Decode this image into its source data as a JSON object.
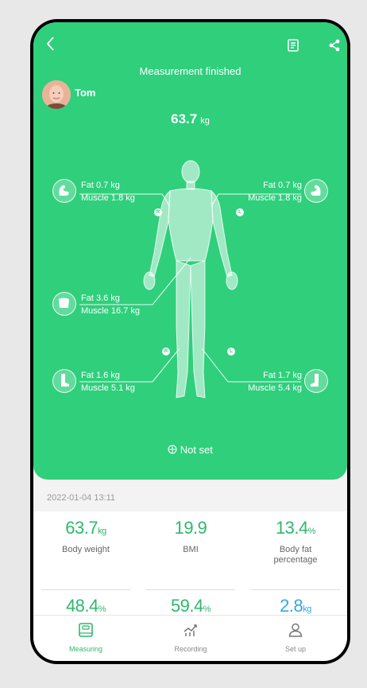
{
  "header": {
    "title": "Measurement finished"
  },
  "user": {
    "name": "Tom"
  },
  "weight": {
    "value": "63.7",
    "unit": "kg"
  },
  "segments": {
    "left_arm": {
      "fat": "Fat 0.7 kg",
      "muscle": "Muscle 1.8 kg"
    },
    "right_arm": {
      "fat": "Fat 0.7 kg",
      "muscle": "Muscle 1.8 kg"
    },
    "trunk": {
      "fat": "Fat 3.6 kg",
      "muscle": "Muscle 16.7 kg"
    },
    "left_leg": {
      "fat": "Fat 1.6 kg",
      "muscle": "Muscle 5.1 kg"
    },
    "right_leg": {
      "fat": "Fat 1.7 kg",
      "muscle": "Muscle 5.4 kg"
    }
  },
  "side_labels": {
    "right": "R",
    "left": "L"
  },
  "not_set": "Not set",
  "date": "2022-01-04 13:11",
  "stats": [
    {
      "value": "63.7",
      "unit": "kg",
      "label": "Body weight"
    },
    {
      "value": "19.9",
      "unit": "",
      "label": "BMI"
    },
    {
      "value": "13.4",
      "unit": "%",
      "label": "Body fat percentage"
    },
    {
      "value": "48.4",
      "unit": "%",
      "label": ""
    },
    {
      "value": "59.4",
      "unit": "%",
      "label": ""
    },
    {
      "value": "2.8",
      "unit": "kg",
      "label": ""
    }
  ],
  "tabs": [
    {
      "label": "Measuring",
      "icon": "scale-icon"
    },
    {
      "label": "Recording",
      "icon": "chart-icon"
    },
    {
      "label": "Set up",
      "icon": "user-icon"
    }
  ],
  "colors": {
    "accent": "#2fcf7c",
    "stat_green": "#2fb86e",
    "stat_blue": "#35a8e0"
  }
}
